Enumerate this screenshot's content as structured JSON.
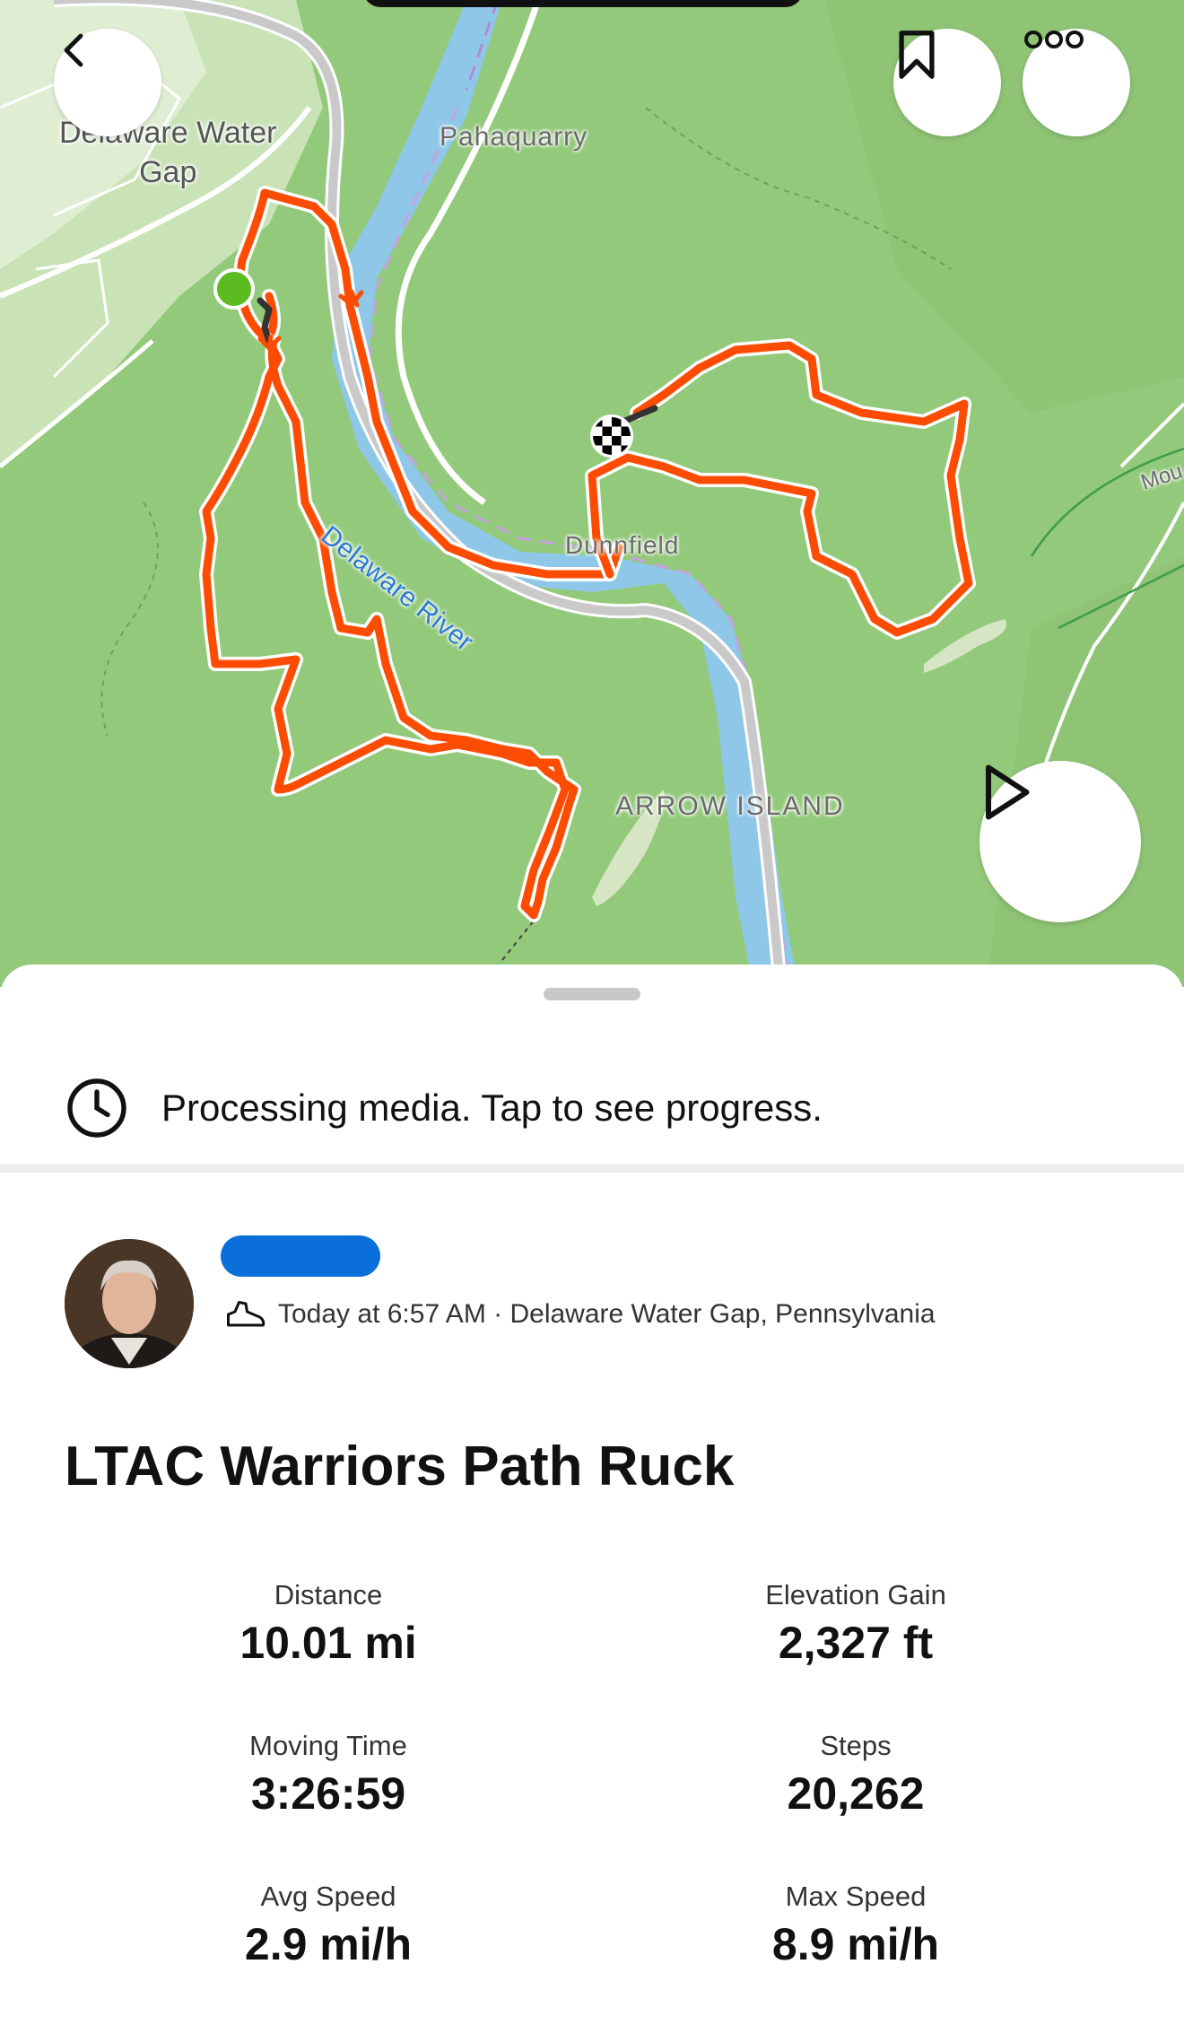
{
  "map": {
    "labels": {
      "town": "Delaware Water\nGap",
      "pahaquarry": "Pahaquarry",
      "river": "Delaware River",
      "dunnfield": "Dunnfield",
      "arrow_island": "ARROW ISLAND",
      "mou": "Mou"
    },
    "icons": {
      "back": "chevron-left-icon",
      "bookmark": "bookmark-icon",
      "more": "more-dots-icon",
      "play": "play-icon",
      "start": "start-marker-icon",
      "finish": "finish-flag-icon"
    },
    "colors": {
      "land": "#93c97a",
      "water": "#8fc7e8",
      "route": "#fc4c02",
      "start": "#5dbb22"
    }
  },
  "banner": {
    "icon": "clock-icon",
    "text": "Processing media. Tap to see progress."
  },
  "activity": {
    "icon": "hiking-shoe-icon",
    "meta": "Today at 6:57 AM · Delaware Water Gap, Pennsylvania",
    "title": "LTAC Warriors Path Ruck"
  },
  "stats": [
    {
      "label": "Distance",
      "value": "10.01 mi"
    },
    {
      "label": "Elevation Gain",
      "value": "2,327 ft"
    },
    {
      "label": "Moving Time",
      "value": "3:26:59"
    },
    {
      "label": "Steps",
      "value": "20,262"
    },
    {
      "label": "Avg Speed",
      "value": "2.9 mi/h"
    },
    {
      "label": "Max Speed",
      "value": "8.9 mi/h"
    }
  ]
}
